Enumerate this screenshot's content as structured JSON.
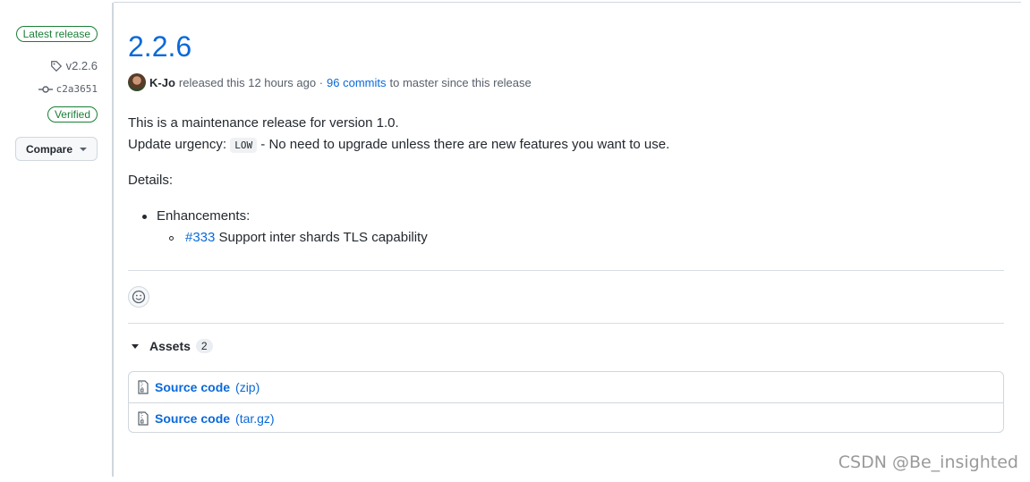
{
  "sidebar": {
    "latest_badge": "Latest release",
    "tag": "v2.2.6",
    "commit": "c2a3651",
    "verified_badge": "Verified",
    "compare_label": "Compare"
  },
  "release": {
    "title": "2.2.6",
    "author": "K-Jo",
    "released_text": "released this 12 hours ago ·",
    "commits_link": "96 commits",
    "commits_suffix": "to master since this release"
  },
  "body": {
    "line1": "This is a maintenance release for version 1.0.",
    "urgency_prefix": "Update urgency:",
    "urgency_code": "LOW",
    "urgency_suffix": "- No need to upgrade unless there are new features you want to use.",
    "details": "Details:",
    "enhancements": "Enhancements:",
    "item_link": "#333",
    "item_text": "Support inter shards TLS capability"
  },
  "assets": {
    "label": "Assets",
    "count": "2",
    "items": [
      {
        "name": "Source code",
        "ext": "(zip)"
      },
      {
        "name": "Source code",
        "ext": "(tar.gz)"
      }
    ]
  },
  "watermark": "CSDN @Be_insighted"
}
